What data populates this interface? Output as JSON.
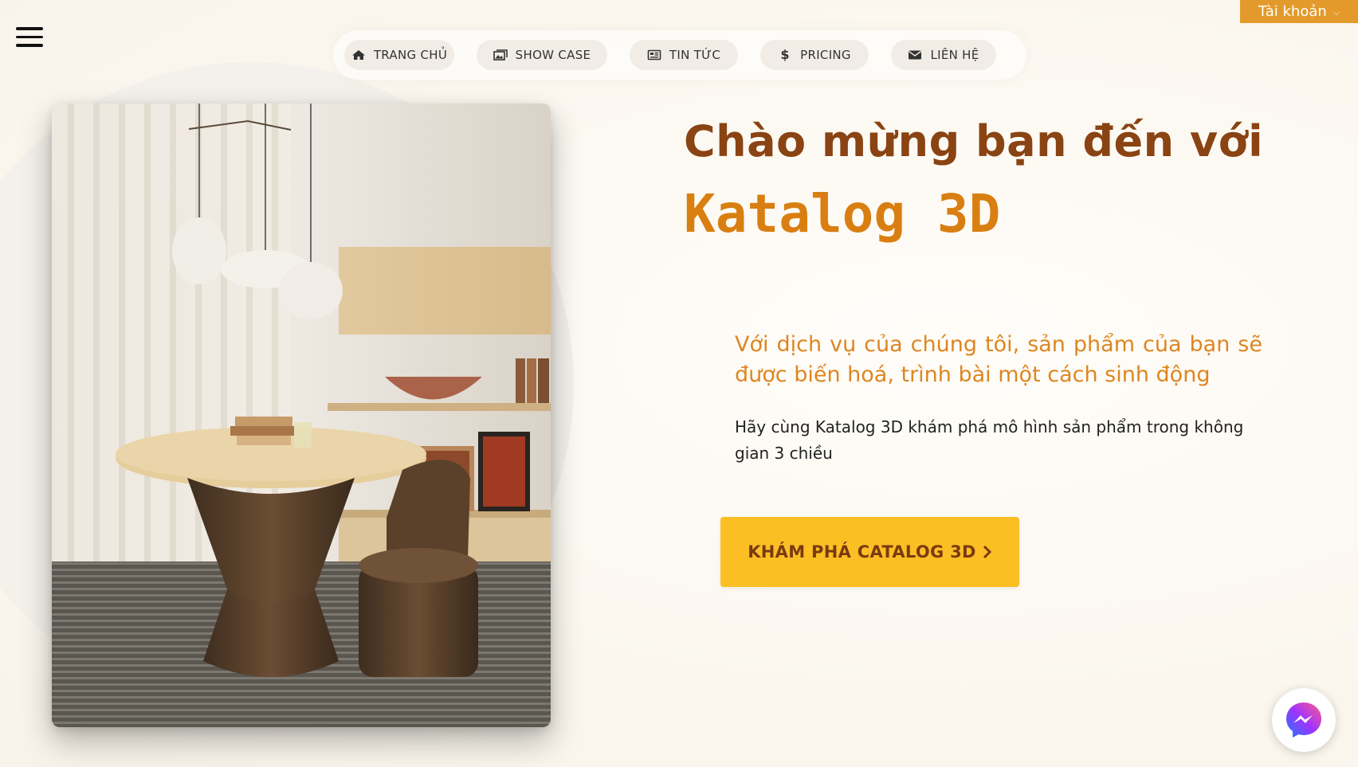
{
  "account": {
    "label": "Tài khoản",
    "caret_icon": "chevron-down-icon"
  },
  "menu": {
    "icon": "hamburger-menu-icon"
  },
  "nav": [
    {
      "label": "TRANG CHỦ",
      "icon": "home-icon"
    },
    {
      "label": "SHOW CASE",
      "icon": "images-icon"
    },
    {
      "label": "TIN TỨC",
      "icon": "newspaper-icon"
    },
    {
      "label": "PRICING",
      "icon": "dollar-icon"
    },
    {
      "label": "LIÊN HỆ",
      "icon": "envelope-icon"
    }
  ],
  "hero": {
    "welcome": "Chào mừng bạn đến với",
    "brand": "Katalog 3D",
    "tagline": "Với dịch vụ của chúng tôi, sản phẩm của bạn sẽ được biến hoá, trình bài một cách sinh động",
    "description": "Hãy cùng Katalog 3D khám phá mô hình sản phẩm trong không gian 3 chiều",
    "cta_label": "KHÁM PHÁ CATALOG 3D",
    "cta_icon": "chevron-right-icon"
  },
  "colors": {
    "accent": "#e39a2b",
    "welcome_text": "#8a4312",
    "brand_text": "#d97f12",
    "cta_bg": "#fbbf24"
  },
  "chat": {
    "icon": "messenger-icon"
  }
}
